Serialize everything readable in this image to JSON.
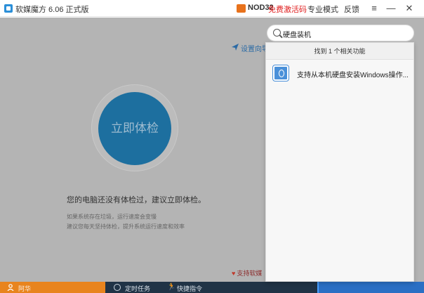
{
  "titlebar": {
    "app_title": "软媒魔方 6.06 正式版",
    "nod_label": "NOD32",
    "nod_promo": "免费激活码",
    "pro_mode": "专业模式",
    "feedback": "反馈",
    "menu_glyph": "≡",
    "minimize_glyph": "—",
    "close_glyph": "✕"
  },
  "main": {
    "guide_link": "设置向导",
    "check_button": "立即体检",
    "status_text": "您的电脑还没有体检过，建议立即体检。",
    "hint_line1": "如果系统存在垃圾，运行速度会变慢",
    "hint_line2": "建议您每天坚持体检，提升系统运行速度和效率",
    "support_label": "支持软媒"
  },
  "search": {
    "value": "硬盘装机"
  },
  "dropdown": {
    "header": "找到 1 个相关功能",
    "results": [
      {
        "label": "支持从本机硬盘安装Windows操作...",
        "icon": "power-icon"
      }
    ]
  },
  "bottombar": {
    "user_label": "阿华",
    "task_label": "定时任务",
    "cmd_label": "快捷指令"
  },
  "colors": {
    "accent_blue": "#1d6f9f",
    "orange": "#e8841e",
    "dark_bar": "#203346",
    "promo_red": "#e02020"
  }
}
